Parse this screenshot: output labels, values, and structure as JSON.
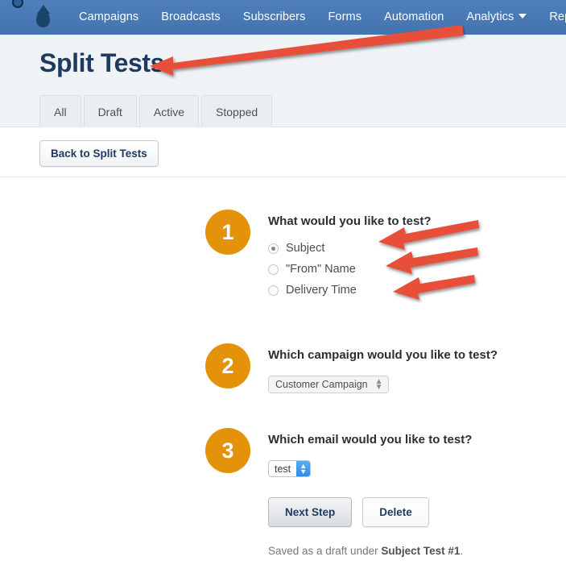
{
  "nav": {
    "logo_icon": "droplet-icon",
    "items": [
      {
        "label": "Campaigns",
        "has_caret": false
      },
      {
        "label": "Broadcasts",
        "has_caret": false
      },
      {
        "label": "Subscribers",
        "has_caret": false
      },
      {
        "label": "Forms",
        "has_caret": false
      },
      {
        "label": "Automation",
        "has_caret": false
      },
      {
        "label": "Analytics",
        "has_caret": true
      },
      {
        "label": "Reports",
        "has_caret": true
      }
    ],
    "background_color": "#4474ae",
    "text_color": "#ffffff"
  },
  "header": {
    "title": "Split Tests",
    "title_color": "#1e3a5f",
    "background_color": "#f0f3f5",
    "tabs": [
      {
        "label": "All"
      },
      {
        "label": "Draft"
      },
      {
        "label": "Active"
      },
      {
        "label": "Stopped"
      }
    ]
  },
  "subbar": {
    "back_button": "Back to Split Tests"
  },
  "steps": [
    {
      "number": "1",
      "question": "What would you like to test?",
      "options": [
        {
          "label": "Subject",
          "selected": true
        },
        {
          "label": "\"From\" Name",
          "selected": false
        },
        {
          "label": "Delivery Time",
          "selected": false
        }
      ]
    },
    {
      "number": "2",
      "question": "Which campaign would you like to test?",
      "select_value": "Customer Campaign",
      "select_icon": "up-down-chevron-icon"
    },
    {
      "number": "3",
      "question": "Which email would you like to test?",
      "select_value": "test",
      "select_icon": "up-down-chevron-icon"
    }
  ],
  "actions": {
    "next_label": "Next Step",
    "delete_label": "Delete"
  },
  "footer": {
    "saved_prefix": "Saved as a draft under ",
    "saved_name": "Subject Test #1",
    "saved_suffix": "."
  },
  "annotations": {
    "arrow_color": "#e8503a",
    "count": 4,
    "targets": [
      "page-title",
      "radio-subject",
      "radio-from-name",
      "radio-delivery-time"
    ]
  }
}
